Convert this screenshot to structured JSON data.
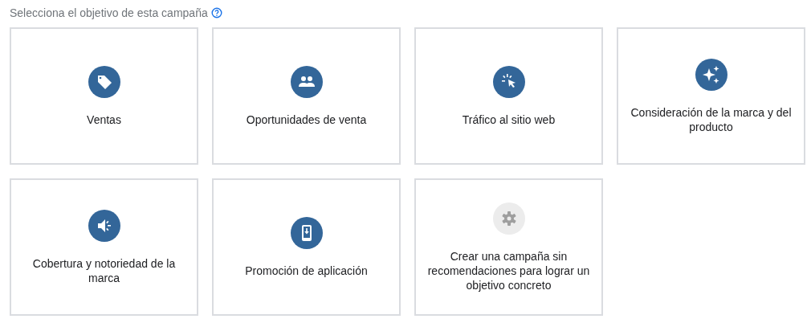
{
  "heading": "Selecciona el objetivo de esta campaña",
  "cards": [
    {
      "kind": "tag",
      "label": "Ventas",
      "muted": false
    },
    {
      "kind": "people",
      "label": "Oportunidades de venta",
      "muted": false
    },
    {
      "kind": "click",
      "label": "Tráfico al sitio web",
      "muted": false
    },
    {
      "kind": "sparkle",
      "label": "Consideración de la marca y del producto",
      "muted": false
    },
    {
      "kind": "megaphone",
      "label": "Cobertura y notoriedad de la marca",
      "muted": false
    },
    {
      "kind": "phone",
      "label": "Promoción de aplicación",
      "muted": false
    },
    {
      "kind": "gear",
      "label": "Crear una campaña sin recomendaciones para lograr un objetivo concreto",
      "muted": true
    }
  ]
}
